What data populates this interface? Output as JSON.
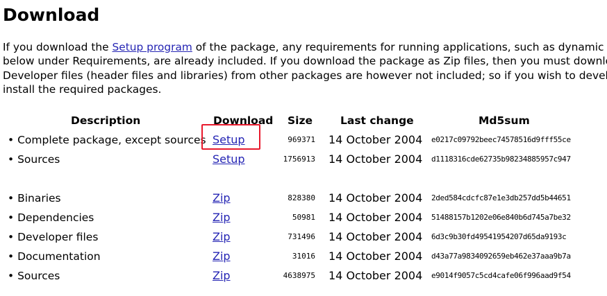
{
  "page": {
    "title": "Download"
  },
  "intro": {
    "line1_before": "If you download the ",
    "setup_link": "Setup program",
    "line1_after": " of the package, any requirements for running applications, such as dynamic li",
    "line2": "below under Requirements, are already included. If you download the package as Zip files, then you must downlo",
    "line3": "Developer files (header files and libraries) from other packages are however not included; so if you wish to develo",
    "line4": "install the required packages."
  },
  "table": {
    "headers": {
      "description": "Description",
      "download": "Download",
      "size": "Size",
      "last_change": "Last change",
      "md5sum": "Md5sum"
    },
    "rows": [
      {
        "description": "• Complete package, except sources",
        "link": "Setup",
        "size": "969371",
        "date": "14 October 2004",
        "md5": "e0217c09792beec74578516d9fff55ce"
      },
      {
        "description": "• Sources",
        "link": "Setup",
        "size": "1756913",
        "date": "14 October 2004",
        "md5": "d1118316cde62735b98234885957c947"
      },
      {
        "description": "• Binaries",
        "link": "Zip",
        "size": "828380",
        "date": "14 October 2004",
        "md5": "2ded584cdcfc87e1e3db257dd5b44651"
      },
      {
        "description": "• Dependencies",
        "link": "Zip",
        "size": "50981",
        "date": "14 October 2004",
        "md5": "51488157b1202e06e840b6d745a7be32"
      },
      {
        "description": "• Developer files",
        "link": "Zip",
        "size": "731496",
        "date": "14 October 2004",
        "md5": "6d3c9b30fd49541954207d65da9193c"
      },
      {
        "description": "• Documentation",
        "link": "Zip",
        "size": "31016",
        "date": "14 October 2004",
        "md5": "d43a77a9834092659eb462e37aaa9b7a"
      },
      {
        "description": "• Sources",
        "link": "Zip",
        "size": "4638975",
        "date": "14 October 2004",
        "md5": "e9014f9057c5cd4cafe06f996aad9f54"
      }
    ]
  },
  "colors": {
    "link": "#2525b4",
    "highlight_border": "#e8192c"
  }
}
